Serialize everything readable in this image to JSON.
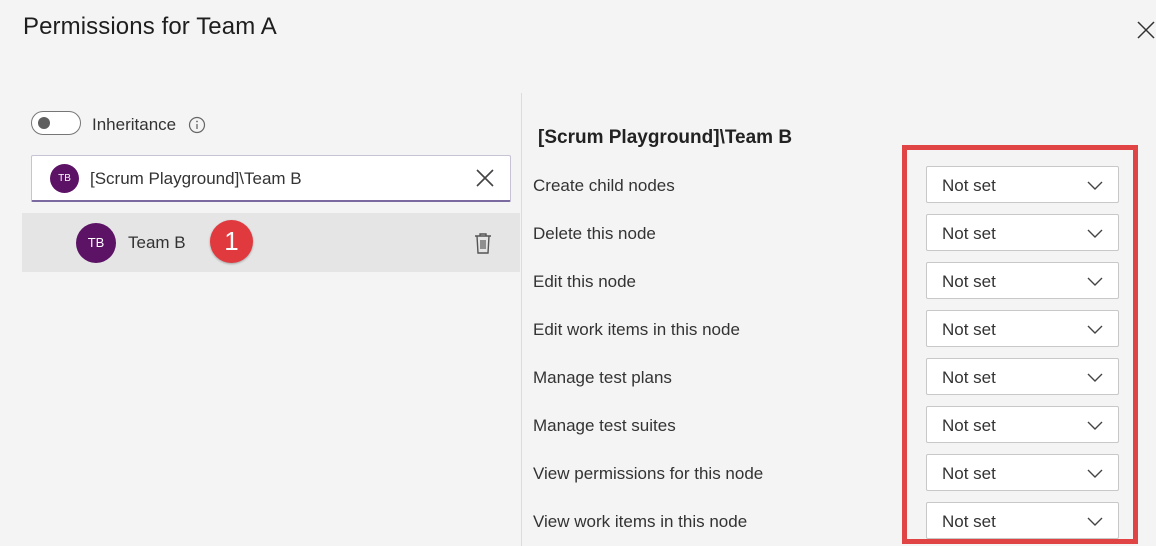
{
  "dialog": {
    "title": "Permissions for Team A"
  },
  "left_panel": {
    "inheritance_label": "Inheritance",
    "search": {
      "avatar_initials": "TB",
      "value": "[Scrum Playground]\\Team B"
    },
    "selected": {
      "avatar_initials": "TB",
      "name": "Team B",
      "badge": "1"
    }
  },
  "right_panel": {
    "heading": "[Scrum Playground]\\Team B",
    "permissions": [
      {
        "label": "Create child nodes",
        "value": "Not set"
      },
      {
        "label": "Delete this node",
        "value": "Not set"
      },
      {
        "label": "Edit this node",
        "value": "Not set"
      },
      {
        "label": "Edit work items in this node",
        "value": "Not set"
      },
      {
        "label": "Manage test plans",
        "value": "Not set"
      },
      {
        "label": "Manage test suites",
        "value": "Not set"
      },
      {
        "label": "View permissions for this node",
        "value": "Not set"
      },
      {
        "label": "View work items in this node",
        "value": "Not set"
      }
    ]
  },
  "colors": {
    "avatar": "#5c1265",
    "badge": "#e0393e",
    "highlight": "#e04444"
  }
}
